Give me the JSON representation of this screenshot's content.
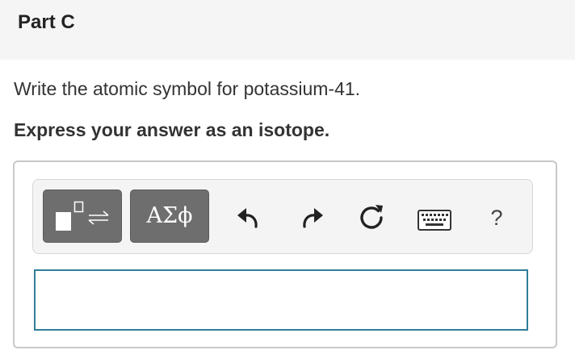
{
  "part": {
    "title": "Part C"
  },
  "question": {
    "prompt": "Write the atomic symbol for potassium-41.",
    "instruction": "Express your answer as an isotope."
  },
  "toolbar": {
    "greek_label": "ΑΣϕ",
    "help_label": "?",
    "icons": {
      "isotope_template": "isotope-template-icon",
      "undo": "undo-icon",
      "redo": "redo-icon",
      "reset": "reset-icon",
      "keyboard": "keyboard-icon"
    }
  },
  "answer": {
    "value": ""
  },
  "colors": {
    "header_bg": "#f5f5f5",
    "button_dark": "#6e6e6e",
    "input_border": "#2f7e9a"
  }
}
